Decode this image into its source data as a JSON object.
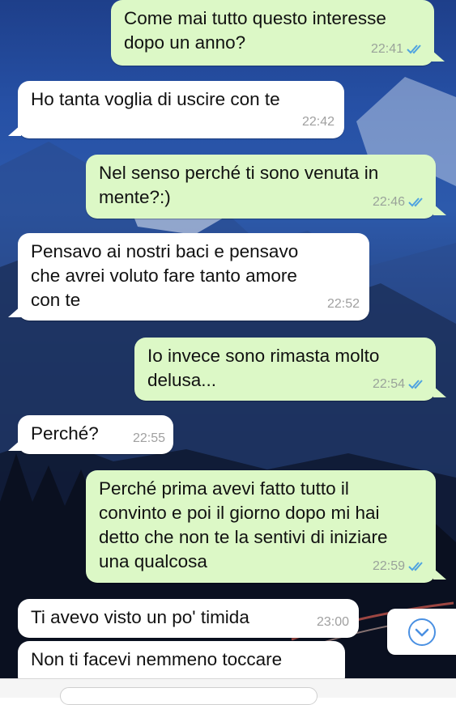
{
  "messages": [
    {
      "direction": "out",
      "text": "Come mai tutto questo interesse\ndopo un anno?",
      "time": "22:41",
      "read": true
    },
    {
      "direction": "in",
      "text": "Ho tanta voglia di uscire con te",
      "time": "22:42"
    },
    {
      "direction": "out",
      "text": "Nel senso perché ti sono venuta in\nmente?:)",
      "time": "22:46",
      "read": true
    },
    {
      "direction": "in",
      "text": "Pensavo ai nostri baci e pensavo\nche avrei voluto fare tanto amore\ncon te",
      "time": "22:52"
    },
    {
      "direction": "out",
      "text": "Io invece sono rimasta molto\ndelusa...",
      "time": "22:54",
      "read": true
    },
    {
      "direction": "in",
      "text": "Perché?",
      "time": "22:55"
    },
    {
      "direction": "out",
      "text": "Perché prima avevi fatto tutto il\nconvinto e poi il giorno dopo mi hai\ndetto che non te la sentivi di iniziare\nuna qualcosa",
      "time": "22:59",
      "read": true
    },
    {
      "direction": "in",
      "text": "Ti avevo visto un po' timida",
      "time": "23:00"
    },
    {
      "direction": "in",
      "text": "Non ti facevi nemmeno toccare",
      "time": ""
    }
  ],
  "icons": {
    "read_receipt": "double-check-icon",
    "scroll_down": "chevron-down-icon"
  },
  "colors": {
    "outgoing_bubble": "#dcf8c6",
    "incoming_bubble": "#ffffff",
    "read_tick": "#4fa3e0",
    "timestamp": "#9aa39a"
  }
}
